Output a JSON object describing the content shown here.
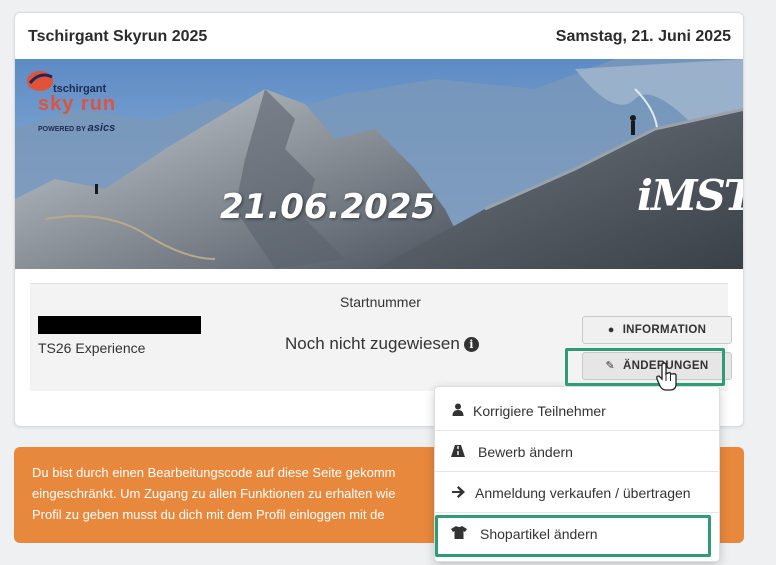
{
  "event": {
    "title": "Tschirgant Skyrun 2025",
    "date": "Samstag, 21. Juni 2025"
  },
  "banner": {
    "date_text": "21.06.2025",
    "logo_line1": "tschirgant",
    "logo_line2": "sky run",
    "logo_powered": "POWERED BY",
    "logo_brand": "asics",
    "town_logo": "iMST"
  },
  "registration": {
    "category": "TS26 Experience",
    "startnumber_label": "Startnummer",
    "startnumber_value": "Noch nicht zugewiesen"
  },
  "buttons": {
    "info_label": "INFORMATION",
    "changes_label": "ÄNDERUNGEN"
  },
  "dropdown": {
    "items": [
      {
        "label": "Korrigiere Teilnehmer",
        "icon": "user-icon"
      },
      {
        "label": "Bewerb ändern",
        "icon": "road-icon"
      },
      {
        "label": "Anmeldung verkaufen / übertragen",
        "icon": "arrow-right-icon"
      },
      {
        "label": "Shopartikel ändern",
        "icon": "tshirt-icon"
      }
    ]
  },
  "alert": {
    "line1": "Du bist durch einen Bearbeitungscode auf diese Seite gekomm",
    "line2": "eingeschränkt. Um Zugang zu allen Funktionen zu erhalten wie",
    "line3": "Profil zu geben musst du dich mit dem Profil einloggen mit de"
  },
  "colors": {
    "accent_highlight": "#2e9c77",
    "alert_bg": "#e8883d"
  }
}
